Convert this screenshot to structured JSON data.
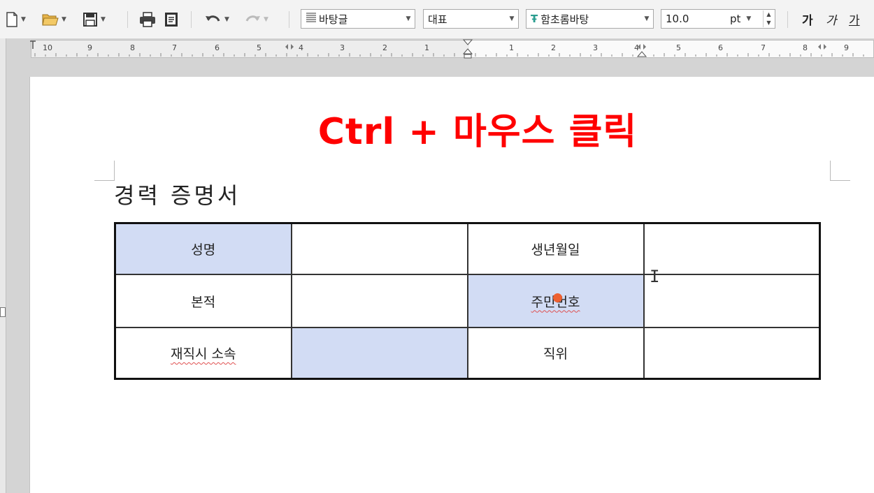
{
  "toolbar": {
    "style_value": "바탕글",
    "language_value": "대표",
    "font_value": "함초롬바탕",
    "font_size_value": "10.0",
    "font_size_unit": "pt",
    "bold_label": "가",
    "italic_label": "가",
    "underline_label": "가"
  },
  "ruler": {
    "numbers_left": [
      "10",
      "9",
      "8",
      "7",
      "6",
      "5",
      "4",
      "3",
      "2",
      "1"
    ],
    "numbers_right": [
      "1",
      "2",
      "3",
      "4",
      "5",
      "6",
      "7",
      "8",
      "9"
    ]
  },
  "document": {
    "overlay_title": "Ctrl + 마우스 클릭",
    "title": "경력 증명서",
    "table": {
      "rows": [
        [
          "성명",
          "",
          "생년월일",
          ""
        ],
        [
          "본적",
          "",
          "주민번호",
          ""
        ],
        [
          "재직시 소속",
          "",
          "직위",
          ""
        ]
      ]
    }
  },
  "colors": {
    "overlay_title": "#ff0000",
    "selected_cell": "#d2dcf4",
    "cursor_dot": "#ee6030"
  }
}
